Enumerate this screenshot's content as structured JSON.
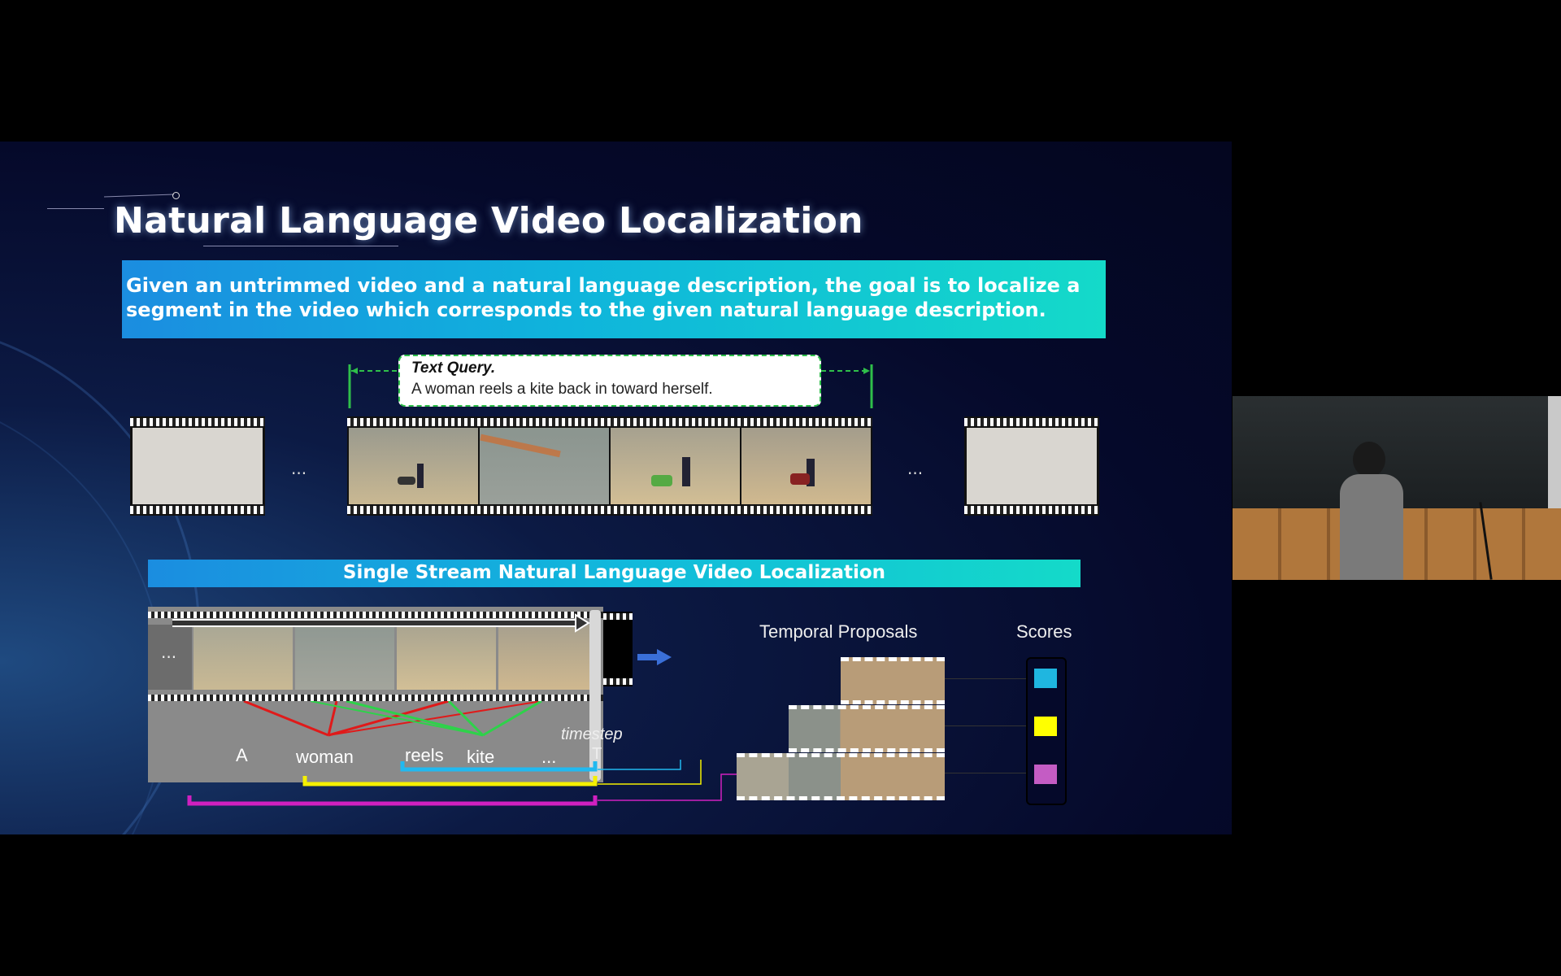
{
  "slide": {
    "title": "Natural Language Video Localization",
    "description": "Given an untrimmed video and a natural language description, the goal is to localize a segment in the video which corresponds to the given natural language description.",
    "query_title": "Text Query.",
    "query_text": "A woman reels a kite back in toward herself.",
    "ellipsis": "...",
    "subsection_title": "Single Stream Natural Language Video Localization",
    "words": [
      "A",
      "woman",
      "reels",
      "kite",
      "..."
    ],
    "timestep_label": "timestep",
    "timestep_value": "T",
    "proposals_label": "Temporal Proposals",
    "scores_label": "Scores"
  },
  "colors": {
    "score_1": "#1fb6e0",
    "score_2": "#ffff00",
    "score_3": "#c45cc4",
    "bracket_blue": "#21b9f0",
    "bracket_yellow": "#f5f000",
    "bracket_magenta": "#d020c0",
    "attention_red": "#e01a1a",
    "attention_green": "#2ed24a"
  },
  "icons": [
    "kite-frame",
    "arrow-right-icon",
    "film-strip"
  ]
}
